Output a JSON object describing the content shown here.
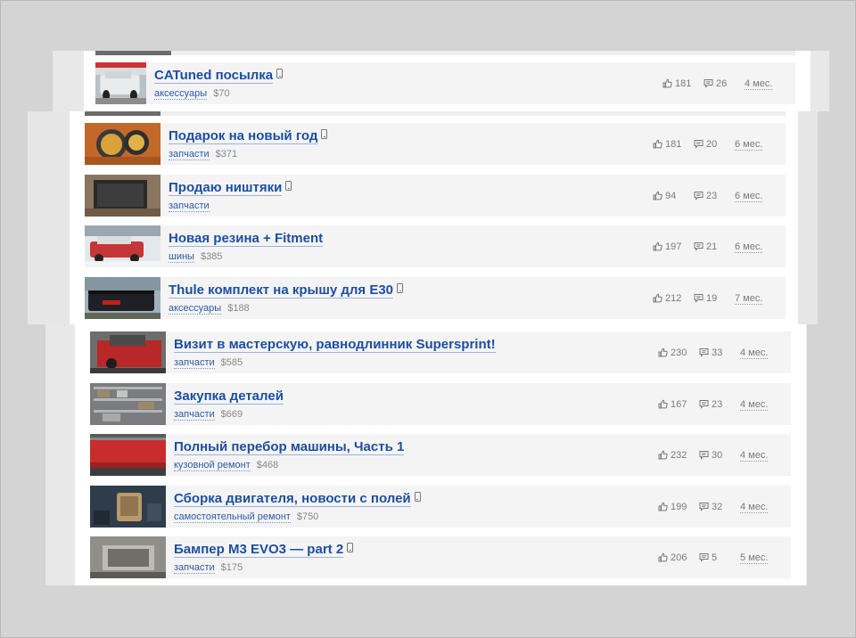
{
  "theme": {
    "title_color": "#1c4fa0",
    "category_color": "#2c5aa8",
    "row_bg": "#f4f4f4",
    "card_bg": "#ffffff",
    "page_bg": "#d4d4d4"
  },
  "icons": {
    "like": "thumbs-up-icon",
    "comments": "comment-icon",
    "mobile": "phone-icon"
  },
  "posts": [
    {
      "title": "CATuned посылка",
      "mobile": true,
      "category": "аксессуары",
      "price": "$70",
      "likes": "181",
      "comments": "26",
      "age": "4 мес.",
      "thumb": "car-white"
    },
    {
      "title": "Подарок на новый год",
      "mobile": true,
      "category": "запчасти",
      "price": "$371",
      "likes": "181",
      "comments": "20",
      "age": "6 мес.",
      "thumb": "headlight"
    },
    {
      "title": "Продаю ништяки",
      "mobile": true,
      "category": "запчасти",
      "price": "",
      "likes": "94",
      "comments": "23",
      "age": "6 мес.",
      "thumb": "parts-dark"
    },
    {
      "title": "Новая резина + Fitment",
      "mobile": false,
      "category": "шины",
      "price": "$385",
      "likes": "197",
      "comments": "21",
      "age": "6 мес.",
      "thumb": "car-snow"
    },
    {
      "title": "Thule комплект на крышу для E30",
      "mobile": true,
      "category": "аксессуары",
      "price": "$188",
      "likes": "212",
      "comments": "19",
      "age": "7 мес.",
      "thumb": "car-roof"
    },
    {
      "title": "Визит в мастерскую, равнодлинник Supersprint!",
      "mobile": false,
      "category": "запчасти",
      "price": "$585",
      "likes": "230",
      "comments": "33",
      "age": "4 мес.",
      "thumb": "red-car"
    },
    {
      "title": "Закупка деталей",
      "mobile": false,
      "category": "запчасти",
      "price": "$669",
      "likes": "167",
      "comments": "23",
      "age": "4 мес.",
      "thumb": "shelves"
    },
    {
      "title": "Полный перебор машины, Часть 1",
      "mobile": false,
      "category": "кузовной ремонт",
      "price": "$468",
      "likes": "232",
      "comments": "30",
      "age": "4 мес.",
      "thumb": "red-side"
    },
    {
      "title": "Сборка двигателя, новости с полей",
      "mobile": true,
      "category": "самостоятельный ремонт",
      "price": "$750",
      "likes": "199",
      "comments": "32",
      "age": "4 мес.",
      "thumb": "engine"
    },
    {
      "title": "Бампер M3 EVO3 — part 2",
      "mobile": true,
      "category": "запчасти",
      "price": "$175",
      "likes": "206",
      "comments": "5",
      "age": "5 мес.",
      "thumb": "bumper"
    }
  ]
}
